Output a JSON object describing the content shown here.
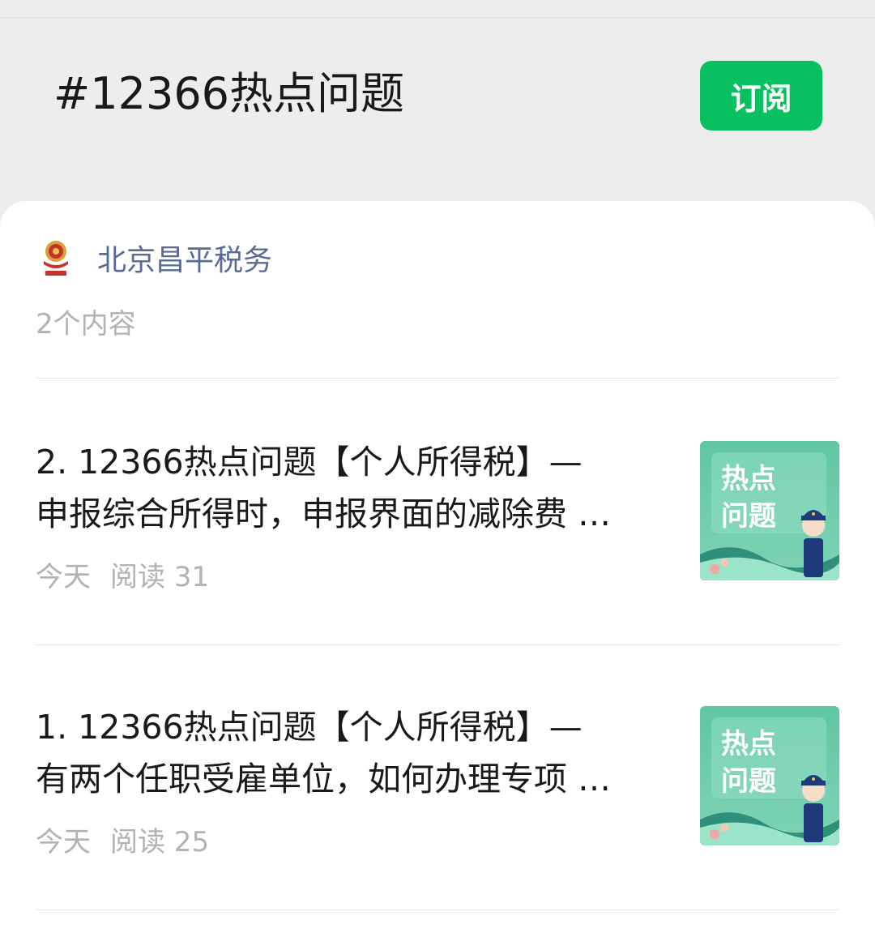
{
  "topic": {
    "title": "#12366热点问题",
    "subscribe_label": "订阅"
  },
  "account": {
    "name": "北京昌平税务",
    "logo_icon": "tax-emblem-icon",
    "content_count": "2个内容"
  },
  "articles": [
    {
      "title_line1": "2. 12366热点问题【个人所得税】—",
      "title_line2": "申报综合所得时，申报界面的减除费 …",
      "date": "今天",
      "reads": "阅读 31",
      "thumb_text_line1": "热点",
      "thumb_text_line2": "问题"
    },
    {
      "title_line1": "1. 12366热点问题【个人所得税】—",
      "title_line2": "有两个任职受雇单位，如何办理专项 …",
      "date": "今天",
      "reads": "阅读 25",
      "thumb_text_line1": "热点",
      "thumb_text_line2": "问题"
    }
  ],
  "colors": {
    "accent": "#07c160",
    "link": "#576b95",
    "muted": "#b2b2b2"
  }
}
